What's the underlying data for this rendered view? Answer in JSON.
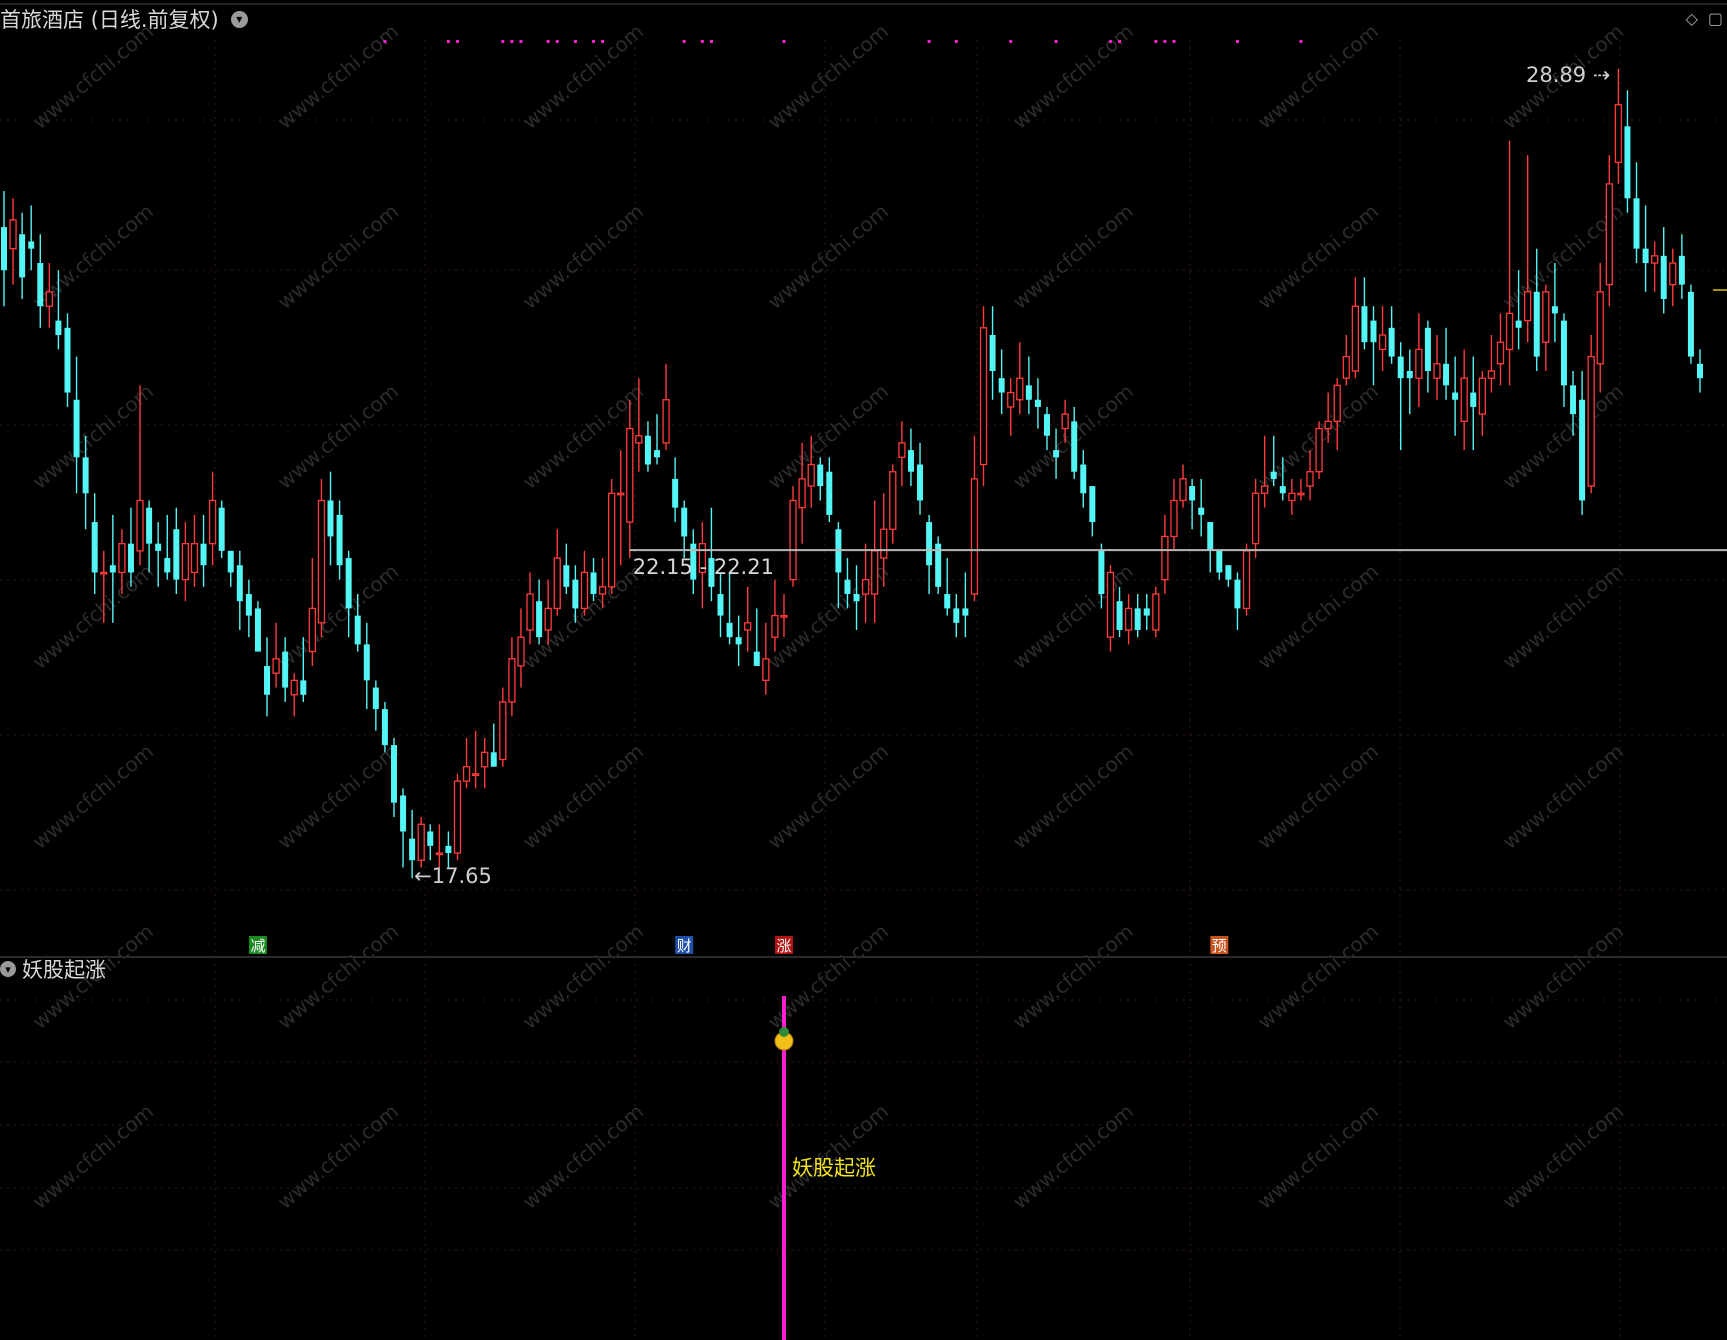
{
  "header": {
    "title": "首旅酒店 (日线.前复权)"
  },
  "indicator_panel": {
    "title": "妖股起涨"
  },
  "watermark": "www.cfchi.com",
  "colors": {
    "up": "#ff3b3b",
    "down": "#54f5f5",
    "magenta": "#ff1fd2",
    "yellow_text": "#f1e21a",
    "grid": "#3a1a1a",
    "hline": "#b8b8b8"
  },
  "chart_data": {
    "type": "candlestick",
    "price_range": [
      17.0,
      29.3
    ],
    "candles": [
      {
        "o": 26.7,
        "h": 27.2,
        "l": 25.6,
        "c": 26.1
      },
      {
        "o": 26.4,
        "h": 27.1,
        "l": 25.9,
        "c": 26.8
      },
      {
        "o": 26.6,
        "h": 26.9,
        "l": 25.7,
        "c": 26.0
      },
      {
        "o": 26.5,
        "h": 27.0,
        "l": 26.1,
        "c": 26.4
      },
      {
        "o": 26.2,
        "h": 26.6,
        "l": 25.3,
        "c": 25.6
      },
      {
        "o": 25.6,
        "h": 26.2,
        "l": 25.3,
        "c": 25.8
      },
      {
        "o": 25.4,
        "h": 26.1,
        "l": 25.0,
        "c": 25.2
      },
      {
        "o": 25.3,
        "h": 25.5,
        "l": 24.2,
        "c": 24.4
      },
      {
        "o": 24.3,
        "h": 24.9,
        "l": 23.0,
        "c": 23.5
      },
      {
        "o": 23.5,
        "h": 23.8,
        "l": 22.5,
        "c": 23.0
      },
      {
        "o": 22.6,
        "h": 23.0,
        "l": 21.6,
        "c": 21.9
      },
      {
        "o": 21.9,
        "h": 22.2,
        "l": 21.2,
        "c": 21.9
      },
      {
        "o": 22.0,
        "h": 22.7,
        "l": 21.2,
        "c": 21.9
      },
      {
        "o": 21.9,
        "h": 22.5,
        "l": 21.6,
        "c": 22.3
      },
      {
        "o": 22.3,
        "h": 22.8,
        "l": 21.7,
        "c": 21.9
      },
      {
        "o": 22.2,
        "h": 24.5,
        "l": 22.0,
        "c": 22.9
      },
      {
        "o": 22.8,
        "h": 22.9,
        "l": 21.9,
        "c": 22.3
      },
      {
        "o": 22.3,
        "h": 22.6,
        "l": 21.7,
        "c": 22.2
      },
      {
        "o": 22.1,
        "h": 22.7,
        "l": 21.8,
        "c": 21.9
      },
      {
        "o": 22.5,
        "h": 22.8,
        "l": 21.6,
        "c": 21.8
      },
      {
        "o": 21.8,
        "h": 22.6,
        "l": 21.5,
        "c": 22.3
      },
      {
        "o": 21.9,
        "h": 22.7,
        "l": 21.7,
        "c": 22.3
      },
      {
        "o": 22.3,
        "h": 22.7,
        "l": 21.7,
        "c": 22.0
      },
      {
        "o": 22.3,
        "h": 23.3,
        "l": 22.0,
        "c": 22.9
      },
      {
        "o": 22.8,
        "h": 22.9,
        "l": 22.1,
        "c": 22.2
      },
      {
        "o": 22.2,
        "h": 22.2,
        "l": 21.7,
        "c": 21.9
      },
      {
        "o": 22.0,
        "h": 22.2,
        "l": 21.1,
        "c": 21.5
      },
      {
        "o": 21.6,
        "h": 21.8,
        "l": 21.0,
        "c": 21.3
      },
      {
        "o": 21.4,
        "h": 21.5,
        "l": 20.8,
        "c": 20.8
      },
      {
        "o": 20.6,
        "h": 21.0,
        "l": 19.9,
        "c": 20.2
      },
      {
        "o": 20.5,
        "h": 21.2,
        "l": 20.3,
        "c": 20.7
      },
      {
        "o": 20.8,
        "h": 21.0,
        "l": 20.1,
        "c": 20.3
      },
      {
        "o": 20.2,
        "h": 20.5,
        "l": 19.9,
        "c": 20.4
      },
      {
        "o": 20.4,
        "h": 21.0,
        "l": 20.1,
        "c": 20.2
      },
      {
        "o": 20.8,
        "h": 22.1,
        "l": 20.6,
        "c": 21.4
      },
      {
        "o": 21.2,
        "h": 23.2,
        "l": 21.0,
        "c": 22.9
      },
      {
        "o": 22.9,
        "h": 23.3,
        "l": 22.0,
        "c": 22.4
      },
      {
        "o": 22.7,
        "h": 22.9,
        "l": 21.8,
        "c": 22.0
      },
      {
        "o": 22.1,
        "h": 22.2,
        "l": 21.0,
        "c": 21.4
      },
      {
        "o": 21.3,
        "h": 21.6,
        "l": 20.8,
        "c": 20.9
      },
      {
        "o": 20.9,
        "h": 21.2,
        "l": 20.0,
        "c": 20.4
      },
      {
        "o": 20.3,
        "h": 20.4,
        "l": 19.7,
        "c": 20.0
      },
      {
        "o": 20.0,
        "h": 20.1,
        "l": 19.4,
        "c": 19.5
      },
      {
        "o": 19.5,
        "h": 19.6,
        "l": 18.5,
        "c": 18.7
      },
      {
        "o": 18.8,
        "h": 18.9,
        "l": 17.8,
        "c": 18.3
      },
      {
        "o": 18.2,
        "h": 18.6,
        "l": 17.65,
        "c": 17.9
      },
      {
        "o": 17.9,
        "h": 18.5,
        "l": 17.8,
        "c": 18.4
      },
      {
        "o": 18.3,
        "h": 18.4,
        "l": 17.9,
        "c": 18.1
      },
      {
        "o": 18.0,
        "h": 18.4,
        "l": 17.8,
        "c": 18.0
      },
      {
        "o": 18.1,
        "h": 18.3,
        "l": 17.8,
        "c": 18.0
      },
      {
        "o": 18.0,
        "h": 19.1,
        "l": 17.9,
        "c": 19.0
      },
      {
        "o": 19.0,
        "h": 19.6,
        "l": 18.9,
        "c": 19.2
      },
      {
        "o": 19.1,
        "h": 19.7,
        "l": 18.9,
        "c": 19.1
      },
      {
        "o": 19.2,
        "h": 19.6,
        "l": 18.9,
        "c": 19.4
      },
      {
        "o": 19.4,
        "h": 19.8,
        "l": 19.2,
        "c": 19.2
      },
      {
        "o": 19.3,
        "h": 20.3,
        "l": 19.2,
        "c": 20.1
      },
      {
        "o": 20.1,
        "h": 21.0,
        "l": 19.9,
        "c": 20.7
      },
      {
        "o": 20.6,
        "h": 21.4,
        "l": 20.3,
        "c": 21.0
      },
      {
        "o": 21.1,
        "h": 21.9,
        "l": 20.9,
        "c": 21.6
      },
      {
        "o": 21.5,
        "h": 21.8,
        "l": 20.9,
        "c": 21.0
      },
      {
        "o": 21.1,
        "h": 21.8,
        "l": 20.9,
        "c": 21.4
      },
      {
        "o": 21.4,
        "h": 22.5,
        "l": 21.3,
        "c": 22.1
      },
      {
        "o": 22.0,
        "h": 22.3,
        "l": 21.6,
        "c": 21.7
      },
      {
        "o": 21.8,
        "h": 22.0,
        "l": 21.2,
        "c": 21.4
      },
      {
        "o": 21.4,
        "h": 22.2,
        "l": 21.3,
        "c": 21.9
      },
      {
        "o": 21.9,
        "h": 22.1,
        "l": 21.5,
        "c": 21.6
      },
      {
        "o": 21.6,
        "h": 22.1,
        "l": 21.4,
        "c": 21.7
      },
      {
        "o": 21.7,
        "h": 23.2,
        "l": 21.6,
        "c": 23.0
      },
      {
        "o": 23.0,
        "h": 23.6,
        "l": 22.0,
        "c": 23.0
      },
      {
        "o": 22.6,
        "h": 24.3,
        "l": 22.1,
        "c": 23.9
      },
      {
        "o": 23.7,
        "h": 24.6,
        "l": 23.3,
        "c": 23.8
      },
      {
        "o": 23.8,
        "h": 24.0,
        "l": 23.3,
        "c": 23.4
      },
      {
        "o": 23.6,
        "h": 24.1,
        "l": 23.4,
        "c": 23.5
      },
      {
        "o": 23.7,
        "h": 24.8,
        "l": 23.6,
        "c": 24.3
      },
      {
        "o": 23.2,
        "h": 23.5,
        "l": 22.6,
        "c": 22.8
      },
      {
        "o": 22.8,
        "h": 22.9,
        "l": 22.1,
        "c": 22.4
      },
      {
        "o": 22.3,
        "h": 22.5,
        "l": 21.6,
        "c": 21.8
      },
      {
        "o": 21.9,
        "h": 22.6,
        "l": 21.4,
        "c": 22.3
      },
      {
        "o": 22.1,
        "h": 22.8,
        "l": 21.5,
        "c": 21.7
      },
      {
        "o": 21.6,
        "h": 21.9,
        "l": 21.0,
        "c": 21.3
      },
      {
        "o": 21.2,
        "h": 21.9,
        "l": 20.9,
        "c": 21.0
      },
      {
        "o": 21.0,
        "h": 21.3,
        "l": 20.6,
        "c": 20.9
      },
      {
        "o": 21.1,
        "h": 21.7,
        "l": 20.8,
        "c": 21.2
      },
      {
        "o": 20.8,
        "h": 21.4,
        "l": 20.6,
        "c": 20.6
      },
      {
        "o": 20.4,
        "h": 21.2,
        "l": 20.2,
        "c": 20.7
      },
      {
        "o": 21.0,
        "h": 21.8,
        "l": 20.8,
        "c": 21.3
      },
      {
        "o": 21.3,
        "h": 21.6,
        "l": 21.0,
        "c": 21.3
      },
      {
        "o": 21.8,
        "h": 23.1,
        "l": 21.7,
        "c": 22.9
      },
      {
        "o": 22.8,
        "h": 23.7,
        "l": 22.3,
        "c": 23.2
      },
      {
        "o": 23.1,
        "h": 23.8,
        "l": 22.8,
        "c": 23.4
      },
      {
        "o": 23.4,
        "h": 23.5,
        "l": 22.9,
        "c": 23.1
      },
      {
        "o": 23.3,
        "h": 23.5,
        "l": 22.6,
        "c": 22.7
      },
      {
        "o": 22.5,
        "h": 22.6,
        "l": 21.4,
        "c": 21.9
      },
      {
        "o": 21.8,
        "h": 22.1,
        "l": 21.4,
        "c": 21.6
      },
      {
        "o": 21.6,
        "h": 22.0,
        "l": 21.1,
        "c": 21.5
      },
      {
        "o": 21.6,
        "h": 22.3,
        "l": 21.2,
        "c": 21.8
      },
      {
        "o": 21.6,
        "h": 22.9,
        "l": 21.2,
        "c": 22.2
      },
      {
        "o": 22.1,
        "h": 23.0,
        "l": 21.7,
        "c": 22.5
      },
      {
        "o": 22.5,
        "h": 23.4,
        "l": 22.3,
        "c": 23.3
      },
      {
        "o": 23.5,
        "h": 24.0,
        "l": 23.1,
        "c": 23.7
      },
      {
        "o": 23.6,
        "h": 23.9,
        "l": 23.1,
        "c": 23.3
      },
      {
        "o": 23.4,
        "h": 23.7,
        "l": 22.7,
        "c": 22.9
      },
      {
        "o": 22.6,
        "h": 22.7,
        "l": 21.6,
        "c": 22.0
      },
      {
        "o": 22.3,
        "h": 22.4,
        "l": 21.6,
        "c": 21.7
      },
      {
        "o": 21.6,
        "h": 22.1,
        "l": 21.3,
        "c": 21.4
      },
      {
        "o": 21.4,
        "h": 21.6,
        "l": 21.0,
        "c": 21.2
      },
      {
        "o": 21.4,
        "h": 21.9,
        "l": 21.0,
        "c": 21.3
      },
      {
        "o": 21.6,
        "h": 23.8,
        "l": 21.5,
        "c": 23.2
      },
      {
        "o": 23.4,
        "h": 25.6,
        "l": 23.1,
        "c": 25.3
      },
      {
        "o": 25.2,
        "h": 25.6,
        "l": 24.3,
        "c": 24.7
      },
      {
        "o": 24.6,
        "h": 25.0,
        "l": 24.1,
        "c": 24.4
      },
      {
        "o": 24.2,
        "h": 24.6,
        "l": 23.8,
        "c": 24.4
      },
      {
        "o": 24.3,
        "h": 25.1,
        "l": 24.1,
        "c": 24.6
      },
      {
        "o": 24.5,
        "h": 24.9,
        "l": 24.1,
        "c": 24.3
      },
      {
        "o": 24.3,
        "h": 24.6,
        "l": 23.9,
        "c": 24.2
      },
      {
        "o": 24.1,
        "h": 24.2,
        "l": 23.6,
        "c": 23.8
      },
      {
        "o": 23.6,
        "h": 23.9,
        "l": 23.2,
        "c": 23.5
      },
      {
        "o": 23.9,
        "h": 24.3,
        "l": 23.7,
        "c": 24.1
      },
      {
        "o": 24.0,
        "h": 24.2,
        "l": 23.2,
        "c": 23.3
      },
      {
        "o": 23.4,
        "h": 23.6,
        "l": 22.8,
        "c": 23.0
      },
      {
        "o": 23.1,
        "h": 23.1,
        "l": 22.4,
        "c": 22.6
      },
      {
        "o": 22.2,
        "h": 22.3,
        "l": 21.4,
        "c": 21.6
      },
      {
        "o": 21.0,
        "h": 22.0,
        "l": 20.8,
        "c": 21.9
      },
      {
        "o": 21.5,
        "h": 21.7,
        "l": 21.0,
        "c": 21.1
      },
      {
        "o": 21.1,
        "h": 21.6,
        "l": 20.9,
        "c": 21.4
      },
      {
        "o": 21.4,
        "h": 21.6,
        "l": 21.0,
        "c": 21.1
      },
      {
        "o": 21.4,
        "h": 21.6,
        "l": 21.1,
        "c": 21.3
      },
      {
        "o": 21.1,
        "h": 21.7,
        "l": 21.0,
        "c": 21.6
      },
      {
        "o": 21.8,
        "h": 22.7,
        "l": 21.6,
        "c": 22.4
      },
      {
        "o": 22.4,
        "h": 23.2,
        "l": 22.2,
        "c": 22.9
      },
      {
        "o": 22.9,
        "h": 23.4,
        "l": 22.8,
        "c": 23.2
      },
      {
        "o": 23.1,
        "h": 23.2,
        "l": 22.5,
        "c": 22.9
      },
      {
        "o": 22.8,
        "h": 23.2,
        "l": 22.4,
        "c": 22.7
      },
      {
        "o": 22.6,
        "h": 22.6,
        "l": 21.9,
        "c": 22.2
      },
      {
        "o": 22.2,
        "h": 22.2,
        "l": 21.8,
        "c": 21.9
      },
      {
        "o": 22.0,
        "h": 22.0,
        "l": 21.7,
        "c": 21.8
      },
      {
        "o": 21.8,
        "h": 21.9,
        "l": 21.1,
        "c": 21.4
      },
      {
        "o": 21.4,
        "h": 22.3,
        "l": 21.3,
        "c": 22.2
      },
      {
        "o": 22.3,
        "h": 23.2,
        "l": 22.1,
        "c": 23.0
      },
      {
        "o": 23.0,
        "h": 23.8,
        "l": 22.8,
        "c": 23.1
      },
      {
        "o": 23.3,
        "h": 23.8,
        "l": 23.1,
        "c": 23.2
      },
      {
        "o": 23.1,
        "h": 23.5,
        "l": 22.9,
        "c": 23.0
      },
      {
        "o": 22.9,
        "h": 23.2,
        "l": 22.7,
        "c": 23.0
      },
      {
        "o": 23.0,
        "h": 23.2,
        "l": 22.9,
        "c": 23.0
      },
      {
        "o": 23.1,
        "h": 23.6,
        "l": 22.9,
        "c": 23.3
      },
      {
        "o": 23.3,
        "h": 24.0,
        "l": 23.2,
        "c": 23.9
      },
      {
        "o": 23.9,
        "h": 24.4,
        "l": 23.7,
        "c": 24.0
      },
      {
        "o": 24.0,
        "h": 24.6,
        "l": 23.6,
        "c": 24.5
      },
      {
        "o": 24.6,
        "h": 25.2,
        "l": 24.5,
        "c": 24.9
      },
      {
        "o": 24.7,
        "h": 26.0,
        "l": 24.6,
        "c": 25.6
      },
      {
        "o": 25.6,
        "h": 26.0,
        "l": 25.0,
        "c": 25.1
      },
      {
        "o": 25.4,
        "h": 25.6,
        "l": 24.5,
        "c": 25.1
      },
      {
        "o": 25.0,
        "h": 25.6,
        "l": 24.7,
        "c": 25.2
      },
      {
        "o": 25.3,
        "h": 25.6,
        "l": 24.8,
        "c": 24.9
      },
      {
        "o": 24.9,
        "h": 25.1,
        "l": 23.6,
        "c": 24.6
      },
      {
        "o": 24.7,
        "h": 25.0,
        "l": 24.1,
        "c": 24.6
      },
      {
        "o": 24.6,
        "h": 25.5,
        "l": 24.2,
        "c": 25.0
      },
      {
        "o": 25.3,
        "h": 25.4,
        "l": 24.4,
        "c": 24.7
      },
      {
        "o": 24.6,
        "h": 25.2,
        "l": 24.3,
        "c": 24.8
      },
      {
        "o": 24.8,
        "h": 25.3,
        "l": 24.3,
        "c": 24.5
      },
      {
        "o": 24.4,
        "h": 24.9,
        "l": 23.8,
        "c": 24.3
      },
      {
        "o": 24.0,
        "h": 25.0,
        "l": 23.6,
        "c": 24.6
      },
      {
        "o": 24.4,
        "h": 24.9,
        "l": 23.6,
        "c": 24.2
      },
      {
        "o": 24.1,
        "h": 24.7,
        "l": 23.8,
        "c": 24.6
      },
      {
        "o": 24.6,
        "h": 25.2,
        "l": 24.4,
        "c": 24.7
      },
      {
        "o": 24.8,
        "h": 25.5,
        "l": 24.5,
        "c": 25.1
      },
      {
        "o": 25.0,
        "h": 27.9,
        "l": 24.5,
        "c": 25.5
      },
      {
        "o": 25.4,
        "h": 26.1,
        "l": 25.0,
        "c": 25.3
      },
      {
        "o": 25.4,
        "h": 27.7,
        "l": 25.1,
        "c": 25.8
      },
      {
        "o": 25.8,
        "h": 26.4,
        "l": 24.7,
        "c": 24.9
      },
      {
        "o": 25.1,
        "h": 25.9,
        "l": 24.7,
        "c": 25.8
      },
      {
        "o": 25.6,
        "h": 26.2,
        "l": 25.1,
        "c": 25.5
      },
      {
        "o": 25.4,
        "h": 25.5,
        "l": 24.2,
        "c": 24.5
      },
      {
        "o": 24.5,
        "h": 24.7,
        "l": 23.8,
        "c": 24.1
      },
      {
        "o": 24.3,
        "h": 24.7,
        "l": 22.7,
        "c": 22.9
      },
      {
        "o": 23.1,
        "h": 25.2,
        "l": 23.0,
        "c": 24.9
      },
      {
        "o": 24.8,
        "h": 26.2,
        "l": 24.4,
        "c": 25.8
      },
      {
        "o": 25.9,
        "h": 27.7,
        "l": 25.6,
        "c": 27.3
      },
      {
        "o": 27.6,
        "h": 28.9,
        "l": 27.3,
        "c": 28.4
      },
      {
        "o": 28.1,
        "h": 28.6,
        "l": 26.9,
        "c": 27.1
      },
      {
        "o": 27.1,
        "h": 27.6,
        "l": 26.2,
        "c": 26.4
      },
      {
        "o": 26.4,
        "h": 27.0,
        "l": 25.8,
        "c": 26.2
      },
      {
        "o": 26.2,
        "h": 26.5,
        "l": 25.8,
        "c": 26.3
      },
      {
        "o": 26.3,
        "h": 26.7,
        "l": 25.5,
        "c": 25.7
      },
      {
        "o": 25.9,
        "h": 26.4,
        "l": 25.6,
        "c": 26.2
      },
      {
        "o": 26.3,
        "h": 26.6,
        "l": 25.7,
        "c": 25.9
      },
      {
        "o": 25.8,
        "h": 25.9,
        "l": 24.8,
        "c": 24.9
      },
      {
        "o": 24.8,
        "h": 25.0,
        "l": 24.4,
        "c": 24.6
      }
    ],
    "annotations": {
      "high_label": "28.89",
      "low_label": "17.65",
      "range_label": "22.15 - 22.21",
      "range_line_price": 22.21,
      "range_start_index": 69
    },
    "event_markers": [
      {
        "index": 28,
        "label": "减",
        "color": "#1e8a24"
      },
      {
        "index": 75,
        "label": "财",
        "color": "#1f4fa8"
      },
      {
        "index": 86,
        "label": "涨",
        "color": "#b31414"
      },
      {
        "index": 134,
        "label": "预",
        "color": "#c8521a"
      }
    ],
    "top_dots": [
      42,
      49,
      50,
      55,
      56,
      57,
      60,
      61,
      63,
      65,
      66,
      75,
      77,
      78,
      86,
      102,
      105,
      111,
      116,
      122,
      123,
      127,
      128,
      129,
      136,
      143
    ],
    "signal": {
      "index": 86,
      "label": "妖股起涨"
    }
  }
}
